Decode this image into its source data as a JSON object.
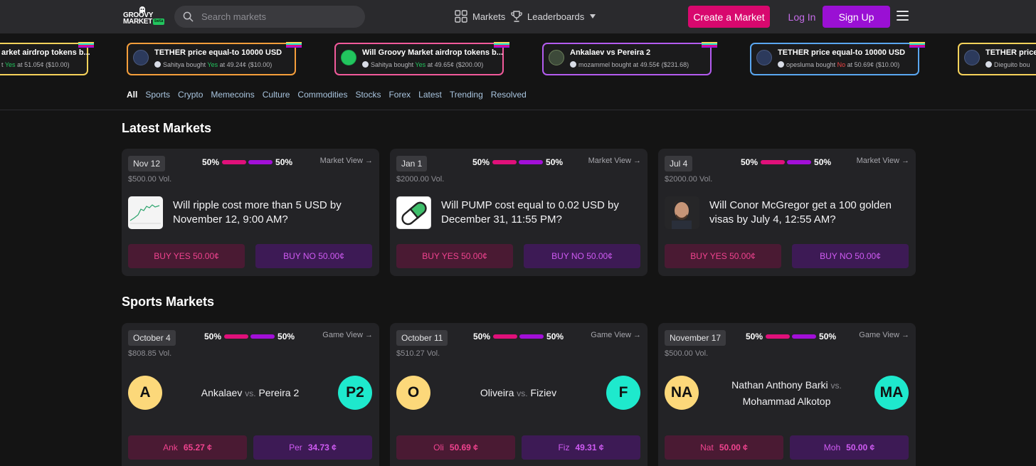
{
  "header": {
    "logo_line1": "GROOVY",
    "logo_line2": "MARKET",
    "logo_badge": "beta",
    "search_placeholder": "Search markets",
    "nav_markets": "Markets",
    "nav_leaderboards": "Leaderboards",
    "create_label": "Create a Market",
    "login_label": "Log In",
    "signup_label": "Sign Up",
    "accent_pink": "#d8086e",
    "accent_purple": "#9a10d4"
  },
  "ticker": [
    {
      "title": "arket airdrop tokens b...",
      "user": "",
      "side": "Yes",
      "price": "51.05¢",
      "amount": "($10.00)",
      "border": "#f7d35b",
      "prefix": "t"
    },
    {
      "title": "TETHER price equal-to 10000 USD",
      "user": "Sahitya",
      "side": "Yes",
      "price": "49.24¢",
      "amount": "($10.00)",
      "border": "#f59e3b",
      "prefix": ""
    },
    {
      "title": "Will Groovy Market airdrop tokens b...",
      "user": "Sahitya",
      "side": "Yes",
      "price": "49.65¢",
      "amount": "($200.00)",
      "border": "#f25a9b",
      "prefix": ""
    },
    {
      "title": "Ankalaev vs Pereira 2",
      "user": "mozammel",
      "side": "",
      "price": "49.55¢",
      "amount": "($231.68)",
      "border": "#b45cf0",
      "prefix": ""
    },
    {
      "title": "TETHER price equal-to 10000 USD",
      "user": "opesluma",
      "side": "No",
      "price": "50.69¢",
      "amount": "($10.00)",
      "border": "#5aa7f0",
      "prefix": ""
    },
    {
      "title": "TETHER price",
      "user": "Dieguito bou",
      "side": "",
      "price": "",
      "amount": "",
      "border": "#f7d35b",
      "prefix": ""
    }
  ],
  "ticker_text": {
    "bought": "bought",
    "at": "at"
  },
  "tabs": [
    "All",
    "Sports",
    "Crypto",
    "Memecoins",
    "Culture",
    "Commodities",
    "Stocks",
    "Forex",
    "Latest",
    "Trending",
    "Resolved"
  ],
  "latest": {
    "title": "Latest Markets",
    "cards": [
      {
        "date": "Nov 12",
        "vol": "$500.00 Vol.",
        "yes_pct": "50%",
        "no_pct": "50%",
        "view": "Market View →",
        "question": "Will ripple cost more than 5 USD by November 12, 9:00 AM?",
        "buy_yes": "BUY YES 50.00¢",
        "buy_no": "BUY NO 50.00¢",
        "thumb": "chart-thumbnail"
      },
      {
        "date": "Jan 1",
        "vol": "$2000.00 Vol.",
        "yes_pct": "50%",
        "no_pct": "50%",
        "view": "Market View →",
        "question": "Will PUMP cost equal to 0.02 USD by December 31, 11:55 PM?",
        "buy_yes": "BUY YES 50.00¢",
        "buy_no": "BUY NO 50.00¢",
        "thumb": "pill-thumbnail"
      },
      {
        "date": "Jul 4",
        "vol": "$2000.00 Vol.",
        "yes_pct": "50%",
        "no_pct": "50%",
        "view": "Market View →",
        "question": "Will Conor McGregor get a 100 golden visas by July 4, 12:55 AM?",
        "buy_yes": "BUY YES 50.00¢",
        "buy_no": "BUY NO 50.00¢",
        "thumb": "person-thumbnail"
      }
    ]
  },
  "sports": {
    "title": "Sports Markets",
    "cards": [
      {
        "date": "October 4",
        "vol": "$808.85 Vol.",
        "yes_pct": "50%",
        "no_pct": "50%",
        "view": "Game View →",
        "team_a": "Ankalaev",
        "team_b": "Pereira 2",
        "vs": "vs.",
        "av_a": "A",
        "av_b": "P2",
        "abbr_a": "Ank",
        "price_a": "65.27 ¢",
        "abbr_b": "Per",
        "price_b": "34.73 ¢"
      },
      {
        "date": "October 11",
        "vol": "$510.27 Vol.",
        "yes_pct": "50%",
        "no_pct": "50%",
        "view": "Game View →",
        "team_a": "Oliveira",
        "team_b": "Fiziev",
        "vs": "vs.",
        "av_a": "O",
        "av_b": "F",
        "abbr_a": "Oli",
        "price_a": "50.69 ¢",
        "abbr_b": "Fiz",
        "price_b": "49.31 ¢"
      },
      {
        "date": "November 17",
        "vol": "$500.00 Vol.",
        "yes_pct": "50%",
        "no_pct": "50%",
        "view": "Game View →",
        "team_a": "Nathan Anthony Barki",
        "team_b": "Mohammad Alkotop",
        "vs": "vs.",
        "av_a": "NA",
        "av_b": "MA",
        "abbr_a": "Nat",
        "price_a": "50.00 ¢",
        "abbr_b": "Moh",
        "price_b": "50.00 ¢"
      }
    ]
  }
}
